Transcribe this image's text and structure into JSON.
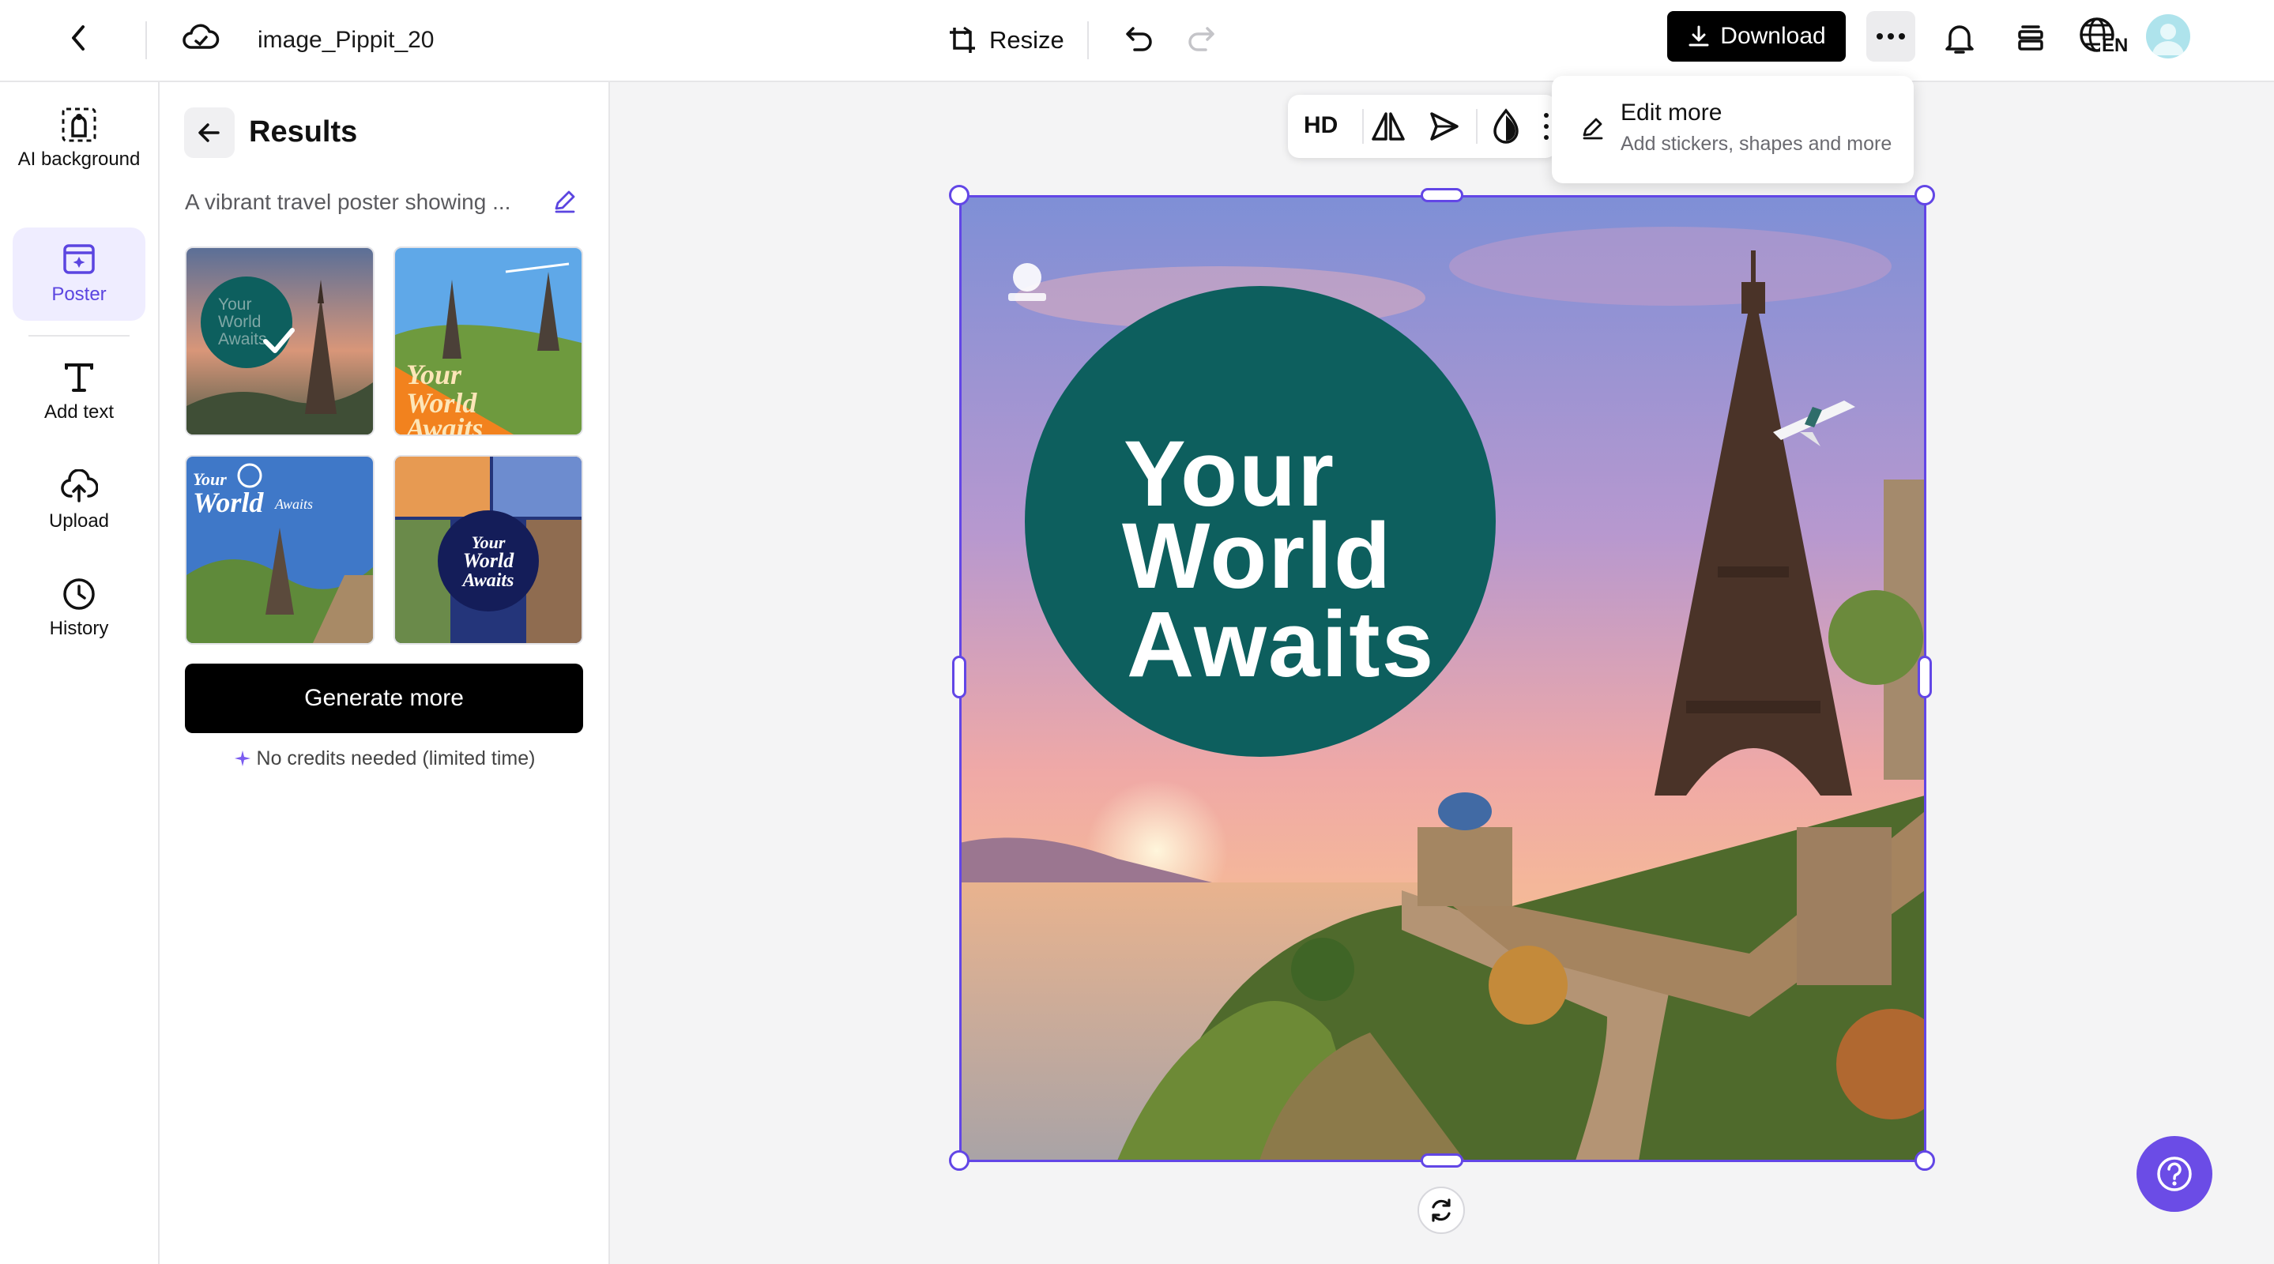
{
  "header": {
    "project_name": "image_Pippit_20",
    "resize_label": "Resize",
    "download_label": "Download",
    "language": "EN"
  },
  "rail": {
    "items": [
      {
        "label": "AI background",
        "icon": "ai-background-icon"
      },
      {
        "label": "Poster",
        "icon": "poster-icon",
        "active": true
      },
      {
        "label": "Add text",
        "icon": "text-icon"
      },
      {
        "label": "Upload",
        "icon": "upload-icon"
      },
      {
        "label": "History",
        "icon": "history-icon"
      }
    ]
  },
  "panel": {
    "title": "Results",
    "prompt": "A vibrant travel poster showing ...",
    "thumbnails": [
      {
        "text": "Your World Awaits",
        "selected": true
      },
      {
        "text": "Your World Awaits"
      },
      {
        "text": "Your World Awaits"
      },
      {
        "text": "Your World Awaits"
      }
    ],
    "generate_label": "Generate more",
    "credits_note": "No credits needed (limited time)"
  },
  "canvas": {
    "toolbar": {
      "hd_label": "HD"
    },
    "popover": {
      "title": "Edit more",
      "subtitle": "Add stickers, shapes and more"
    },
    "poster": {
      "line1": "Your",
      "line2": "World",
      "line3": "Awaits"
    }
  },
  "colors": {
    "accent": "#6246e6",
    "circle": "#0d5f5e",
    "help": "#6b4ce6"
  }
}
